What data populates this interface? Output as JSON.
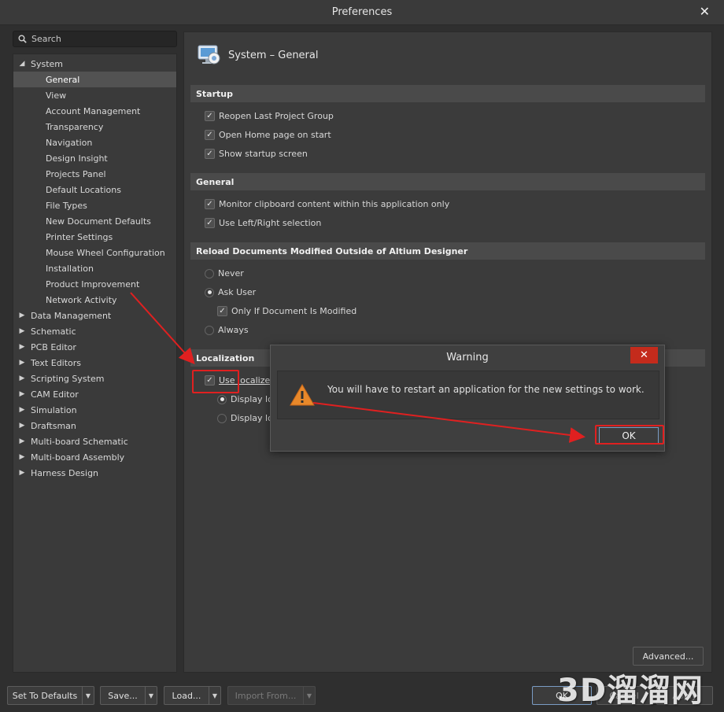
{
  "window": {
    "title": "Preferences",
    "close_glyph": "✕"
  },
  "search": {
    "placeholder": "Search"
  },
  "tree": {
    "system": {
      "label": "System",
      "expanded": true
    },
    "system_children": [
      "General",
      "View",
      "Account Management",
      "Transparency",
      "Navigation",
      "Design Insight",
      "Projects Panel",
      "Default Locations",
      "File Types",
      "New Document Defaults",
      "Printer Settings",
      "Mouse Wheel Configuration",
      "Installation",
      "Product Improvement",
      "Network Activity"
    ],
    "selected": "General",
    "top_level": [
      "Data Management",
      "Schematic",
      "PCB Editor",
      "Text Editors",
      "Scripting System",
      "CAM Editor",
      "Simulation",
      "Draftsman",
      "Multi-board Schematic",
      "Multi-board Assembly",
      "Harness Design"
    ]
  },
  "page": {
    "title": "System – General",
    "sections": {
      "startup": "Startup",
      "general": "General",
      "reload": "Reload Documents Modified Outside of Altium Designer",
      "localization": "Localization"
    },
    "startup_options": [
      {
        "label": "Reopen Last Project Group",
        "checked": true
      },
      {
        "label": "Open Home page on start",
        "checked": true
      },
      {
        "label": "Show startup screen",
        "checked": true
      }
    ],
    "general_options": [
      {
        "label": "Monitor clipboard content within this application only",
        "checked": true
      },
      {
        "label": "Use Left/Right selection",
        "checked": true
      }
    ],
    "reload_options": {
      "never": "Never",
      "ask_user": "Ask User",
      "only_if_modified": "Only If Document Is Modified",
      "always": "Always",
      "selected": "Ask User"
    },
    "localization": {
      "use_localized": "Use localized",
      "display_1": "Display loc",
      "display_2": "Display loc",
      "use_localized_checked": true
    },
    "advanced_button": "Advanced..."
  },
  "bottom_bar": {
    "set_to_defaults": "Set To Defaults",
    "save": "Save...",
    "load": "Load...",
    "import_from": "Import From...",
    "ok": "OK",
    "cancel": "Cancel",
    "apply": "Apply"
  },
  "dialog": {
    "title": "Warning",
    "close_glyph": "✕",
    "message": "You will have to restart an application for the new settings to work.",
    "ok": "OK"
  },
  "watermark": "3D溜溜网",
  "colors": {
    "highlight": "#e02020",
    "warning_icon": "#e8882a",
    "close_button": "#c42b1c"
  }
}
